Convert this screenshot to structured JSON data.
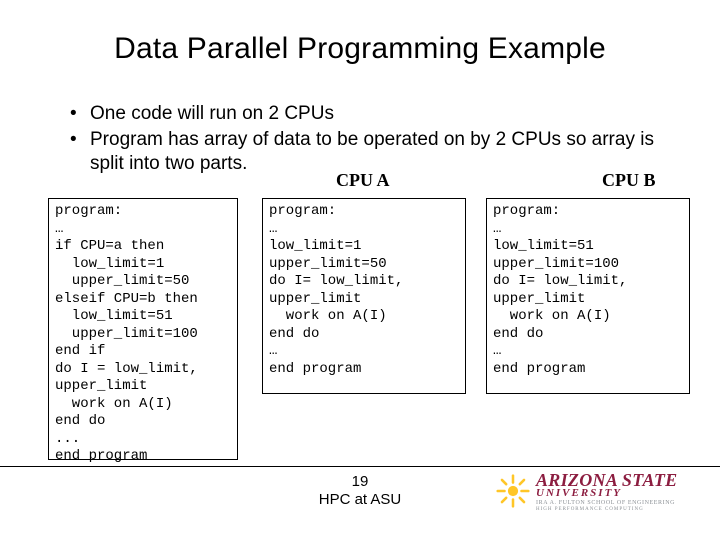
{
  "title": "Data Parallel Programming Example",
  "bullets": [
    "One code will run on 2 CPUs",
    "Program has array of data to be operated on by 2 CPUs so array is split into two parts."
  ],
  "cpu_labels": {
    "a": "CPU A",
    "b": "CPU B"
  },
  "code": {
    "main": "program:\n…\nif CPU=a then\n  low_limit=1\n  upper_limit=50\nelseif CPU=b then\n  low_limit=51\n  upper_limit=100\nend if\ndo I = low_limit,\nupper_limit\n  work on A(I)\nend do\n...\nend program",
    "cpu_a": "program:\n…\nlow_limit=1\nupper_limit=50\ndo I= low_limit,\nupper_limit\n  work on A(I)\nend do\n…\nend program",
    "cpu_b": "program:\n…\nlow_limit=51\nupper_limit=100\ndo I= low_limit,\nupper_limit\n  work on A(I)\nend do\n…\nend program"
  },
  "footer": {
    "page": "19",
    "subtitle": "HPC at ASU"
  },
  "logo": {
    "line1": "ARIZONA STATE",
    "line2": "UNIVERSITY",
    "tag1": "IRA A. FULTON SCHOOL OF ENGINEERING",
    "tag2": "HIGH PERFORMANCE COMPUTING",
    "maroon": "#8c1d40",
    "gold": "#ffc627"
  }
}
